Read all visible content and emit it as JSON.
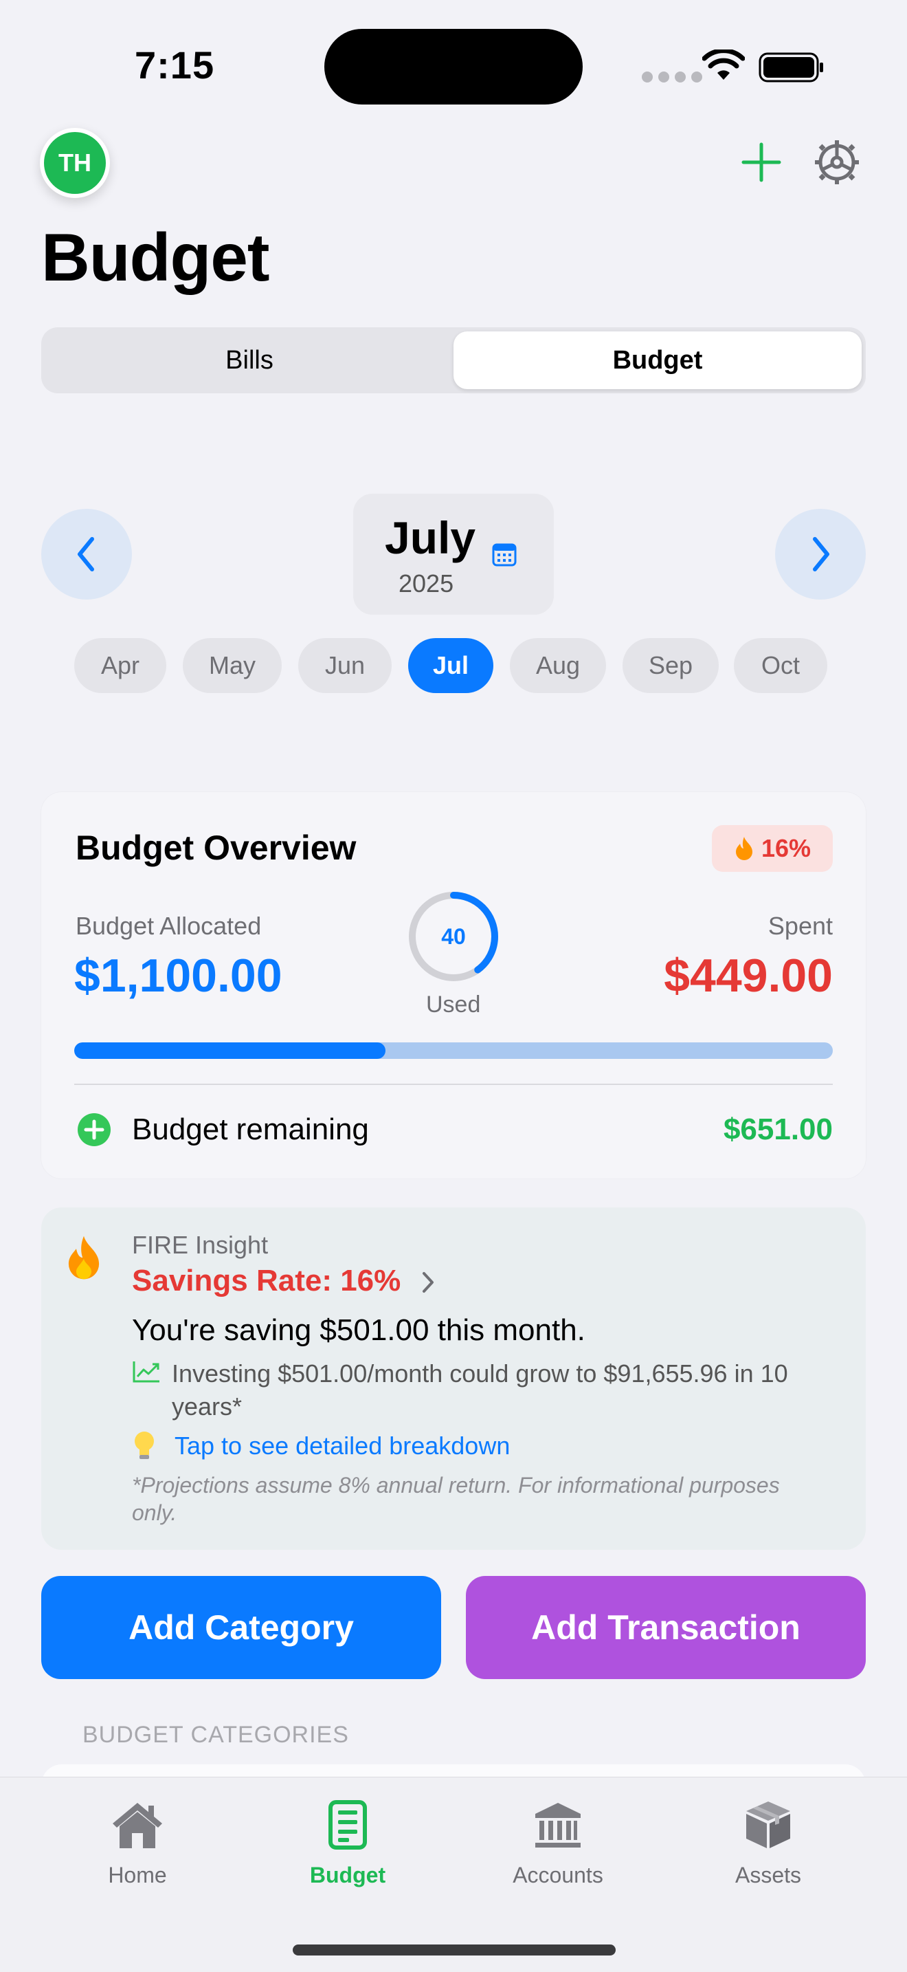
{
  "status_bar": {
    "time": "7:15"
  },
  "header": {
    "avatar_initials": "TH",
    "title": "Budget"
  },
  "segments": [
    {
      "label": "Bills",
      "active": false
    },
    {
      "label": "Budget",
      "active": true
    }
  ],
  "month_nav": {
    "month": "July",
    "year": "2025"
  },
  "months": [
    {
      "label": "Apr",
      "active": false
    },
    {
      "label": "May",
      "active": false
    },
    {
      "label": "Jun",
      "active": false
    },
    {
      "label": "Jul",
      "active": true
    },
    {
      "label": "Aug",
      "active": false
    },
    {
      "label": "Sep",
      "active": false
    },
    {
      "label": "Oct",
      "active": false
    }
  ],
  "overview": {
    "title": "Budget Overview",
    "badge": "16%",
    "allocated_label": "Budget Allocated",
    "allocated_value": "$1,100.00",
    "spent_label": "Spent",
    "spent_value": "$449.00",
    "used_percent": "40",
    "used_label": "Used",
    "progress_fraction": 0.41,
    "remaining_label": "Budget remaining",
    "remaining_value": "$651.00"
  },
  "fire": {
    "kicker": "FIRE Insight",
    "rate": "Savings Rate: 16%",
    "saving": "You're saving $501.00 this month.",
    "investing": "Investing $501.00/month could grow to $91,655.96 in 10 years*",
    "tap": "Tap to see detailed breakdown",
    "note": "*Projections assume 8% annual return. For informational purposes only."
  },
  "actions": {
    "add_category": "Add Category",
    "add_transaction": "Add Transaction"
  },
  "section": {
    "categories_header": "BUDGET CATEGORIES"
  },
  "tabs": [
    {
      "label": "Home",
      "icon": "home-icon",
      "active": false
    },
    {
      "label": "Budget",
      "icon": "budget-icon",
      "active": true
    },
    {
      "label": "Accounts",
      "icon": "bank-icon",
      "active": false
    },
    {
      "label": "Assets",
      "icon": "box-icon",
      "active": false
    }
  ],
  "colors": {
    "accent": "#0a7aff",
    "brand_green": "#1db954",
    "danger": "#e53935",
    "purple": "#af52de"
  }
}
